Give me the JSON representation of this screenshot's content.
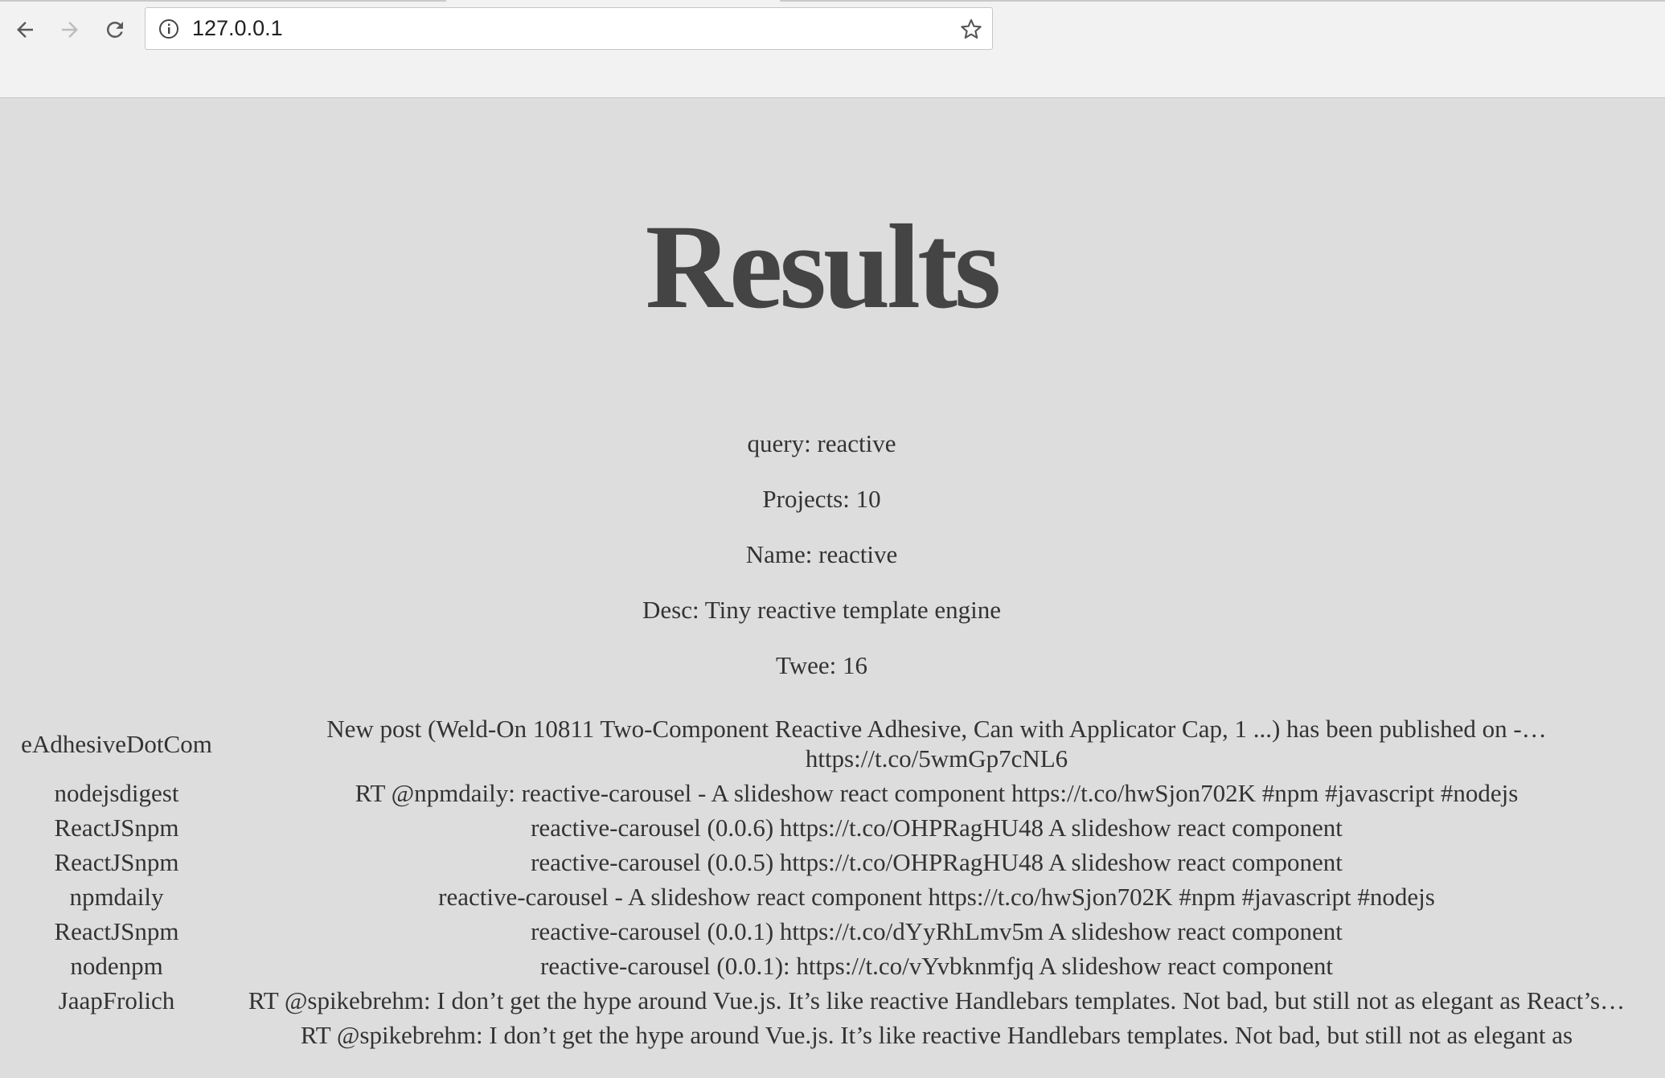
{
  "browser": {
    "url": "127.0.0.1",
    "icons": {
      "back": "arrow-left-icon",
      "forward": "arrow-right-icon",
      "reload": "reload-icon",
      "info": "info-icon",
      "bookmark": "star-icon"
    }
  },
  "page": {
    "title": "Results",
    "query_line": "query: reactive",
    "projects_line": "Projects: 10",
    "name_line": "Name: reactive",
    "desc_line": "Desc: Tiny reactive template engine",
    "tweets_line": "Twee: 16"
  },
  "tweets": [
    {
      "user": "eAdhesiveDotCom",
      "text": "New post (Weld-On 10811 Two-Component Reactive Adhesive, Can with Applicator Cap, 1 ...) has been published on -… https://t.co/5wmGp7cNL6"
    },
    {
      "user": "nodejsdigest",
      "text": "RT @npmdaily: reactive-carousel - A slideshow react component https://t.co/hwSjon702K #npm #javascript #nodejs"
    },
    {
      "user": "ReactJSnpm",
      "text": "reactive-carousel (0.0.6) https://t.co/OHPRagHU48 A slideshow react component"
    },
    {
      "user": "ReactJSnpm",
      "text": "reactive-carousel (0.0.5) https://t.co/OHPRagHU48 A slideshow react component"
    },
    {
      "user": "npmdaily",
      "text": "reactive-carousel - A slideshow react component https://t.co/hwSjon702K #npm #javascript #nodejs"
    },
    {
      "user": "ReactJSnpm",
      "text": "reactive-carousel (0.0.1) https://t.co/dYyRhLmv5m A slideshow react component"
    },
    {
      "user": "nodenpm",
      "text": "reactive-carousel (0.0.1): https://t.co/vYvbknmfjq A slideshow react component"
    },
    {
      "user": "JaapFrolich",
      "text": "RT @spikebrehm: I don’t get the hype around Vue.js. It’s like reactive Handlebars templates. Not bad, but still not as elegant as React’s…"
    },
    {
      "user": "",
      "text": "RT @spikebrehm: I don’t get the hype around Vue.js. It’s like reactive Handlebars templates. Not bad, but still not as elegant as"
    }
  ]
}
